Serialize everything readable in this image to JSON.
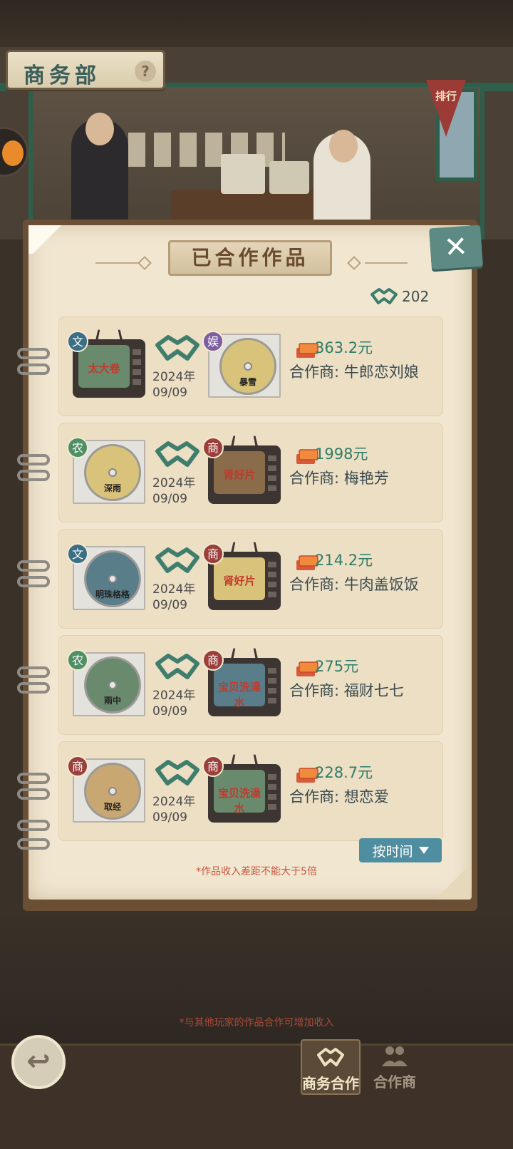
{
  "header": {
    "title": "商务部",
    "help_icon": "question-icon"
  },
  "scene": {
    "pennant_text": "排行"
  },
  "panel": {
    "title": "已合作作品",
    "coop_count": "202",
    "close_icon": "close-icon"
  },
  "rows": [
    {
      "left_category": "文",
      "left_art": "太大卷",
      "date_year": "2024年",
      "date_md": "09/09",
      "right_category": "娱",
      "right_art": "暴雪",
      "amount": "363.2元",
      "partner": "合作商: 牛郎恋刘娘"
    },
    {
      "left_category": "农",
      "left_art": "深雨",
      "date_year": "2024年",
      "date_md": "09/09",
      "right_category": "商",
      "right_art": "肾好片",
      "amount": "1998元",
      "partner": "合作商: 梅艳芳"
    },
    {
      "left_category": "文",
      "left_art": "明珠格格",
      "date_year": "2024年",
      "date_md": "09/09",
      "right_category": "商",
      "right_art": "肾好片",
      "amount": "214.2元",
      "partner": "合作商: 牛肉盖饭饭"
    },
    {
      "left_category": "农",
      "left_art": "雨中",
      "date_year": "2024年",
      "date_md": "09/09",
      "right_category": "商",
      "right_art": "宝贝洗澡水",
      "amount": "275元",
      "partner": "合作商: 福财七七"
    },
    {
      "left_category": "商",
      "left_art": "取经",
      "date_year": "2024年",
      "date_md": "09/09",
      "right_category": "商",
      "right_art": "宝贝洗澡水",
      "amount": "228.7元",
      "partner": "合作商: 想恋爱"
    }
  ],
  "sort_button": {
    "label": "按时间"
  },
  "notes": {
    "income_gap": "*作品收入差距不能大于5倍",
    "tip": "*与其他玩家的作品合作可增加收入"
  },
  "bottom_tabs": [
    {
      "label": "商务合作",
      "icon": "handshake-icon",
      "active": true
    },
    {
      "label": "合作商",
      "icon": "people-icon",
      "active": false
    }
  ],
  "colors": {
    "accent_green": "#2e7d69",
    "category_文": "#3a6f86",
    "category_农": "#4e8f63",
    "category_娱": "#7c5fa0",
    "category_商": "#9b3f3a"
  }
}
